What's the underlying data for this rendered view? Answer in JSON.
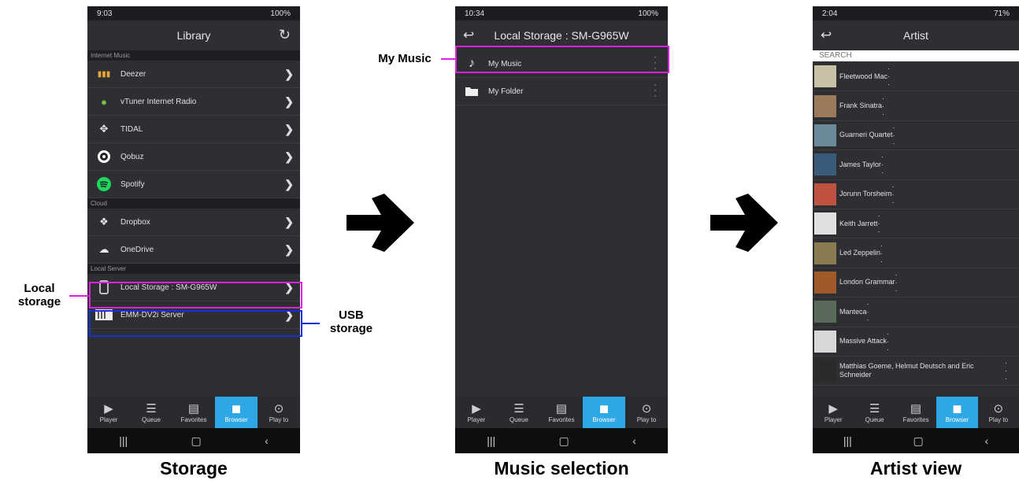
{
  "phone1": {
    "status_time": "9:03",
    "status_right": "100%",
    "title": "Library",
    "sections": {
      "internet": "Internet Music",
      "cloud": "Cloud",
      "local": "Local Server"
    },
    "internet_items": [
      "Deezer",
      "vTuner Internet Radio",
      "TIDAL",
      "Qobuz",
      "Spotify"
    ],
    "cloud_items": [
      "Dropbox",
      "OneDrive"
    ],
    "local_items": [
      "Local Storage : SM-G965W",
      "EMM-DV2i Server"
    ]
  },
  "phone2": {
    "status_time": "10:34",
    "status_right": "100%",
    "title": "Local Storage : SM-G965W",
    "items": [
      "My Music",
      "My Folder"
    ]
  },
  "phone3": {
    "status_time": "2:04",
    "status_right": "71%",
    "title": "Artist",
    "search_placeholder": "SEARCH",
    "artists": [
      "Fleetwood Mac",
      "Frank Sinatra",
      "Guarneri Quartet",
      "James Taylor",
      "Jorunn Torsheim",
      "Keith Jarrett",
      "Led Zeppelin",
      "London Grammar",
      "Manteca",
      "Massive Attack",
      "Matthias Goeme, Helmut Deutsch and Eric Schneider"
    ]
  },
  "tabs": [
    "Player",
    "Queue",
    "Favorites",
    "Browser",
    "Play to"
  ],
  "annotations": {
    "local_storage": "Local storage",
    "usb_storage": "USB storage",
    "my_music": "My Music"
  },
  "captions": {
    "storage": "Storage",
    "music_selection": "Music selection",
    "artist_view": "Artist view"
  },
  "colors": {
    "highlight_magenta": "#e020e0",
    "highlight_blue": "#1530d8",
    "active_tab": "#2ea7e6"
  }
}
